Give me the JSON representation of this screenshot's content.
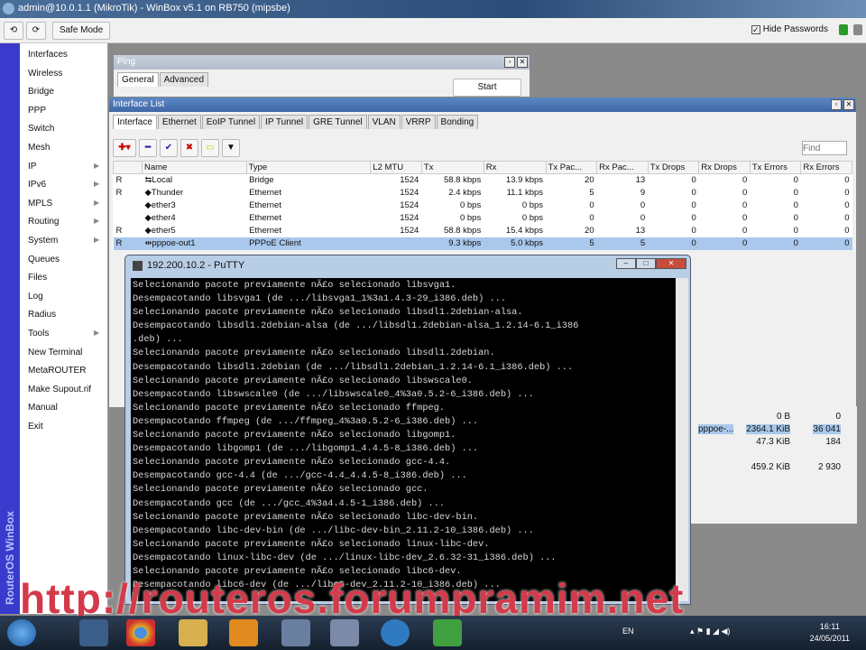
{
  "window": {
    "title": "admin@10.0.1.1 (MikroTik) - WinBox v5.1 on RB750 (mipsbe)"
  },
  "toolbar": {
    "undo": "⟲",
    "redo": "⟳",
    "safe_mode": "Safe Mode",
    "hide_passwords": "Hide Passwords",
    "hide_passwords_checked": true
  },
  "brand": "RouterOS WinBox",
  "sidebar": [
    {
      "label": "Interfaces"
    },
    {
      "label": "Wireless"
    },
    {
      "label": "Bridge"
    },
    {
      "label": "PPP"
    },
    {
      "label": "Switch"
    },
    {
      "label": "Mesh"
    },
    {
      "label": "IP",
      "sub": true
    },
    {
      "label": "IPv6",
      "sub": true
    },
    {
      "label": "MPLS",
      "sub": true
    },
    {
      "label": "Routing",
      "sub": true
    },
    {
      "label": "System",
      "sub": true
    },
    {
      "label": "Queues"
    },
    {
      "label": "Files"
    },
    {
      "label": "Log"
    },
    {
      "label": "Radius"
    },
    {
      "label": "Tools",
      "sub": true
    },
    {
      "label": "New Terminal"
    },
    {
      "label": "MetaROUTER"
    },
    {
      "label": "Make Supout.rif"
    },
    {
      "label": "Manual"
    },
    {
      "label": "Exit"
    }
  ],
  "ping": {
    "title": "Ping",
    "tabs": [
      "General",
      "Advanced"
    ],
    "start": "Start"
  },
  "iflist": {
    "title": "Interface List",
    "tabs": [
      "Interface",
      "Ethernet",
      "EoIP Tunnel",
      "IP Tunnel",
      "GRE Tunnel",
      "VLAN",
      "VRRP",
      "Bonding"
    ],
    "find_placeholder": "Find",
    "columns": [
      "",
      "Name",
      "Type",
      "L2 MTU",
      "Tx",
      "Rx",
      "Tx Pac...",
      "Rx Pac...",
      "Tx Drops",
      "Rx Drops",
      "Tx Errors",
      "Rx Errors"
    ],
    "rows": [
      [
        "R",
        "⇆Local",
        "Bridge",
        "1524",
        "58.8 kbps",
        "13.9 kbps",
        "20",
        "13",
        "0",
        "0",
        "0",
        "0"
      ],
      [
        "R",
        "◆Thunder",
        "Ethernet",
        "1524",
        "2.4 kbps",
        "11.1 kbps",
        "5",
        "9",
        "0",
        "0",
        "0",
        "0"
      ],
      [
        "",
        "◆ether3",
        "Ethernet",
        "1524",
        "0 bps",
        "0 bps",
        "0",
        "0",
        "0",
        "0",
        "0",
        "0"
      ],
      [
        "",
        "◆ether4",
        "Ethernet",
        "1524",
        "0 bps",
        "0 bps",
        "0",
        "0",
        "0",
        "0",
        "0",
        "0"
      ],
      [
        "R",
        "◆ether5",
        "Ethernet",
        "1524",
        "58.8 kbps",
        "15.4 kbps",
        "20",
        "13",
        "0",
        "0",
        "0",
        "0"
      ],
      [
        "R",
        "⇹pppoe-out1",
        "PPPoE Client",
        "",
        "9.3 kbps",
        "5.0 kbps",
        "5",
        "5",
        "0",
        "0",
        "0",
        "0"
      ]
    ]
  },
  "stats": {
    "rows": [
      [
        "",
        "0 B",
        "0"
      ],
      [
        "pppoe-...",
        "2364.1 KiB",
        "36 041"
      ],
      [
        "",
        "47.3 KiB",
        "184"
      ],
      [
        "",
        "459.2 KiB",
        "2 930"
      ]
    ]
  },
  "putty": {
    "title": "192.200.10.2 - PuTTY",
    "lines": [
      "Selecionando pacote previamente nÃ£o selecionado libsvga1.",
      "Desempacotando libsvga1 (de .../libsvga1_1%3a1.4.3-29_i386.deb) ...",
      "Selecionando pacote previamente nÃ£o selecionado libsdl1.2debian-alsa.",
      "Desempacotando libsdl1.2debian-alsa (de .../libsdl1.2debian-alsa_1.2.14-6.1_i386",
      ".deb) ...",
      "Selecionando pacote previamente nÃ£o selecionado libsdl1.2debian.",
      "Desempacotando libsdl1.2debian (de .../libsdl1.2debian_1.2.14-6.1_i386.deb) ...",
      "Selecionando pacote previamente nÃ£o selecionado libswscale0.",
      "Desempacotando libswscale0 (de .../libswscale0_4%3a0.5.2-6_i386.deb) ...",
      "Selecionando pacote previamente nÃ£o selecionado ffmpeg.",
      "Desempacotando ffmpeg (de .../ffmpeg_4%3a0.5.2-6_i386.deb) ...",
      "Selecionando pacote previamente nÃ£o selecionado libgomp1.",
      "Desempacotando libgomp1 (de .../libgomp1_4.4.5-8_i386.deb) ...",
      "Selecionando pacote previamente nÃ£o selecionado gcc-4.4.",
      "Desempacotando gcc-4.4 (de .../gcc-4.4_4.4.5-8_i386.deb) ...",
      "Selecionando pacote previamente nÃ£o selecionado gcc.",
      "Desempacotando gcc (de .../gcc_4%3a4.4.5-1_i386.deb) ...",
      "Selecionando pacote previamente nÃ£o selecionado libc-dev-bin.",
      "Desempacotando libc-dev-bin (de .../libc-dev-bin_2.11.2-10_i386.deb) ...",
      "Selecionando pacote previamente nÃ£o selecionado linux-libc-dev.",
      "Desempacotando linux-libc-dev (de .../linux-libc-dev_2.6.32-31_i386.deb) ...",
      "Selecionando pacote previamente nÃ£o selecionado libc6-dev.",
      "Desempacotando libc6-dev (de .../libc6-dev_2.11.2-10_i386.deb) ..."
    ]
  },
  "watermark": "http://routeros.forumpramim.net",
  "taskbar": {
    "lang": "EN",
    "time": "16:11",
    "date": "24/05/2011"
  }
}
